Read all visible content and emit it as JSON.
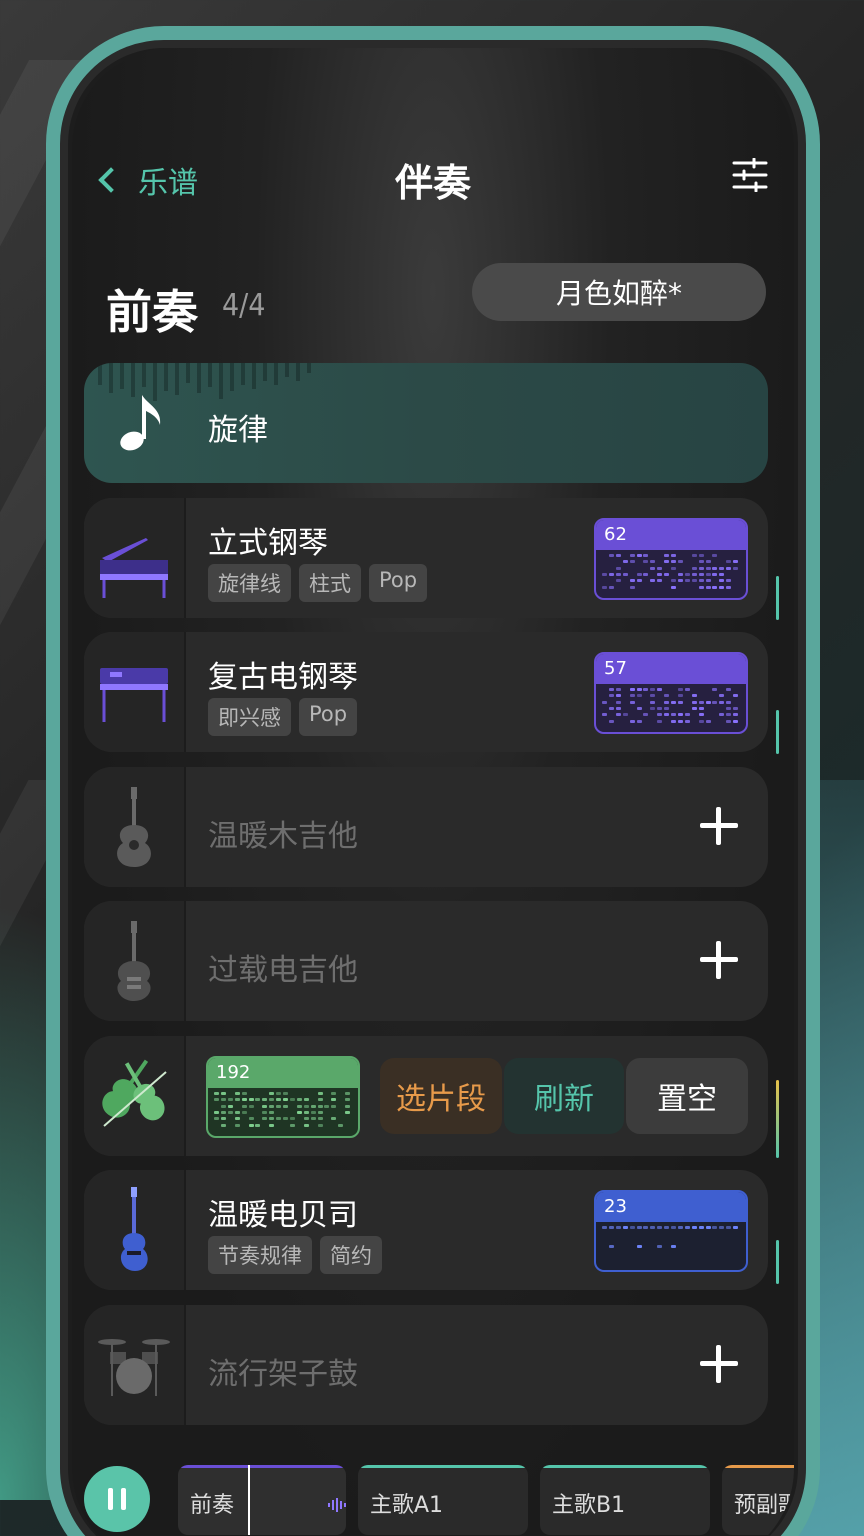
{
  "nav": {
    "back_label": "乐谱",
    "title": "伴奏"
  },
  "section": {
    "title": "前奏",
    "count": "4/4",
    "style_label": "月色如醉*"
  },
  "melody": {
    "label": "旋律"
  },
  "tracks": [
    {
      "name": "立式钢琴",
      "icon": "upright-piano-icon",
      "tags": [
        "旋律线",
        "柱式",
        "Pop"
      ],
      "pattern_number": "62",
      "pattern_color": "#6a4fd6",
      "active": true
    },
    {
      "name": "复古电钢琴",
      "icon": "electric-piano-icon",
      "tags": [
        "即兴感",
        "Pop"
      ],
      "pattern_number": "57",
      "pattern_color": "#6a4fd6",
      "active": true
    },
    {
      "name": "温暖木吉他",
      "icon": "acoustic-guitar-icon",
      "tags": [],
      "active": false
    },
    {
      "name": "过载电吉他",
      "icon": "electric-guitar-icon",
      "tags": [],
      "active": false
    },
    {
      "name": "",
      "icon": "strings-icon",
      "pattern_number": "192",
      "pattern_color": "#5aa86a",
      "active": true,
      "actions": {
        "select": "选片段",
        "refresh": "刷新",
        "clear": "置空"
      }
    },
    {
      "name": "温暖电贝司",
      "icon": "bass-guitar-icon",
      "tags": [
        "节奏规律",
        "简约"
      ],
      "pattern_number": "23",
      "pattern_color": "#3f5fd0",
      "active": true
    },
    {
      "name": "流行架子鼓",
      "icon": "drum-kit-icon",
      "tags": [],
      "active": false
    }
  ],
  "timeline": {
    "segments": [
      "前奏",
      "主歌A1",
      "主歌B1",
      "预副歌"
    ]
  },
  "colors": {
    "accent": "#55c5ab",
    "select_text": "#e79a4a",
    "refresh_text": "#55c5ab"
  }
}
